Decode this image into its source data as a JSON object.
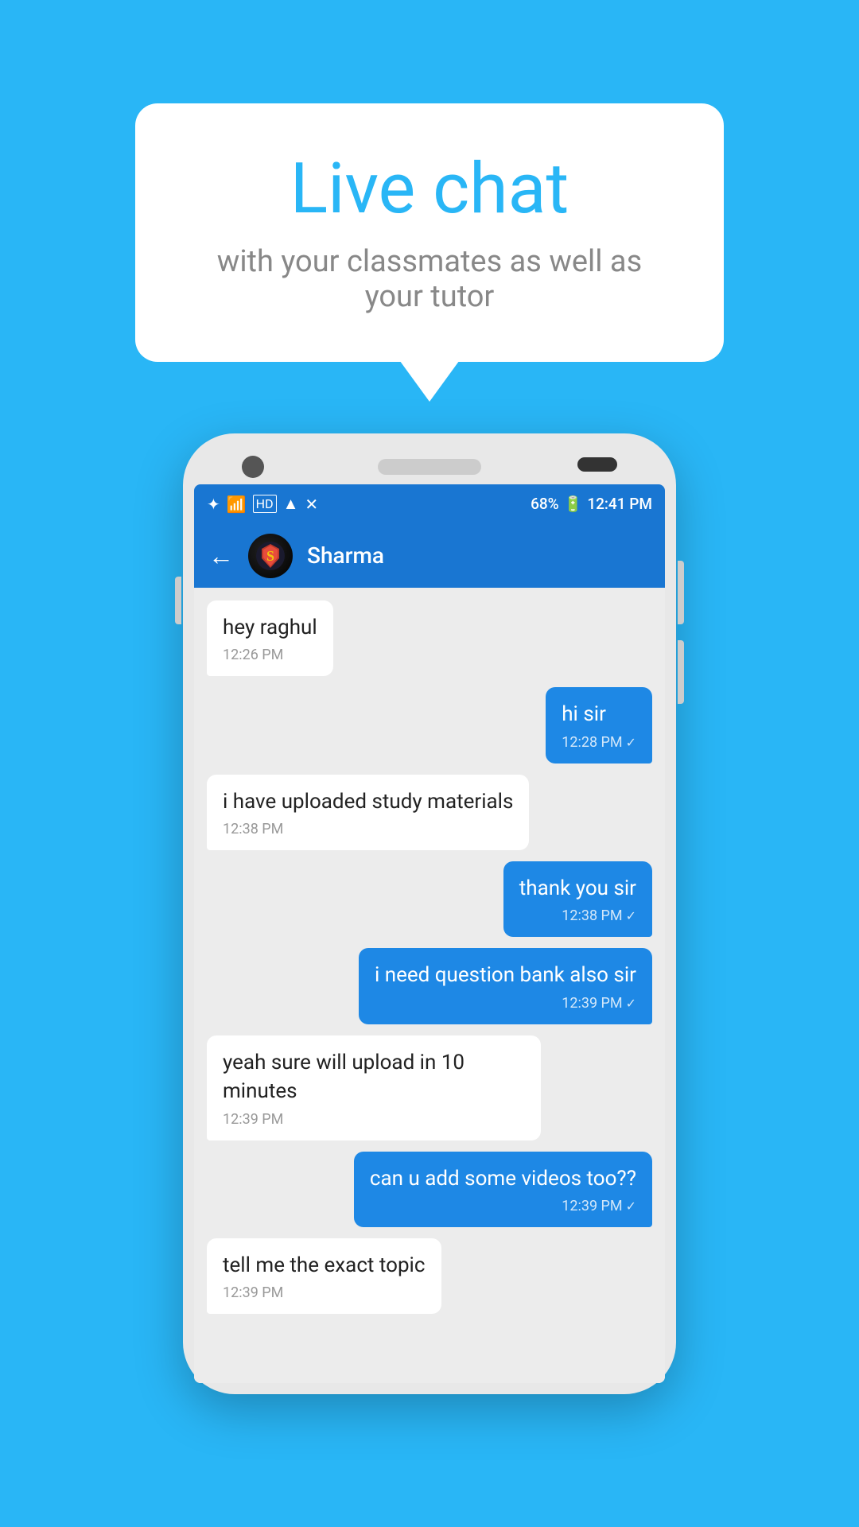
{
  "background_color": "#29b6f6",
  "bubble": {
    "title": "Live chat",
    "subtitle": "with your classmates as well as your tutor"
  },
  "phone": {
    "status_bar": {
      "time": "12:41 PM",
      "battery": "68%",
      "icons": "bluetooth signal hd wifi signal"
    },
    "app_bar": {
      "contact_name": "Sharma",
      "back_label": "←"
    },
    "messages": [
      {
        "id": "msg1",
        "type": "received",
        "text": "hey raghul",
        "time": "12:26 PM",
        "checkmark": false
      },
      {
        "id": "msg2",
        "type": "sent",
        "text": "hi sir",
        "time": "12:28 PM",
        "checkmark": true
      },
      {
        "id": "msg3",
        "type": "received",
        "text": "i have uploaded study materials",
        "time": "12:38 PM",
        "checkmark": false
      },
      {
        "id": "msg4",
        "type": "sent",
        "text": "thank you sir",
        "time": "12:38 PM",
        "checkmark": true
      },
      {
        "id": "msg5",
        "type": "sent",
        "text": "i need question bank also sir",
        "time": "12:39 PM",
        "checkmark": true
      },
      {
        "id": "msg6",
        "type": "received",
        "text": "yeah sure will upload in 10 minutes",
        "time": "12:39 PM",
        "checkmark": false
      },
      {
        "id": "msg7",
        "type": "sent",
        "text": "can u add some videos too??",
        "time": "12:39 PM",
        "checkmark": true
      },
      {
        "id": "msg8",
        "type": "received",
        "text": "tell me the exact topic",
        "time": "12:39 PM",
        "checkmark": false
      }
    ]
  }
}
